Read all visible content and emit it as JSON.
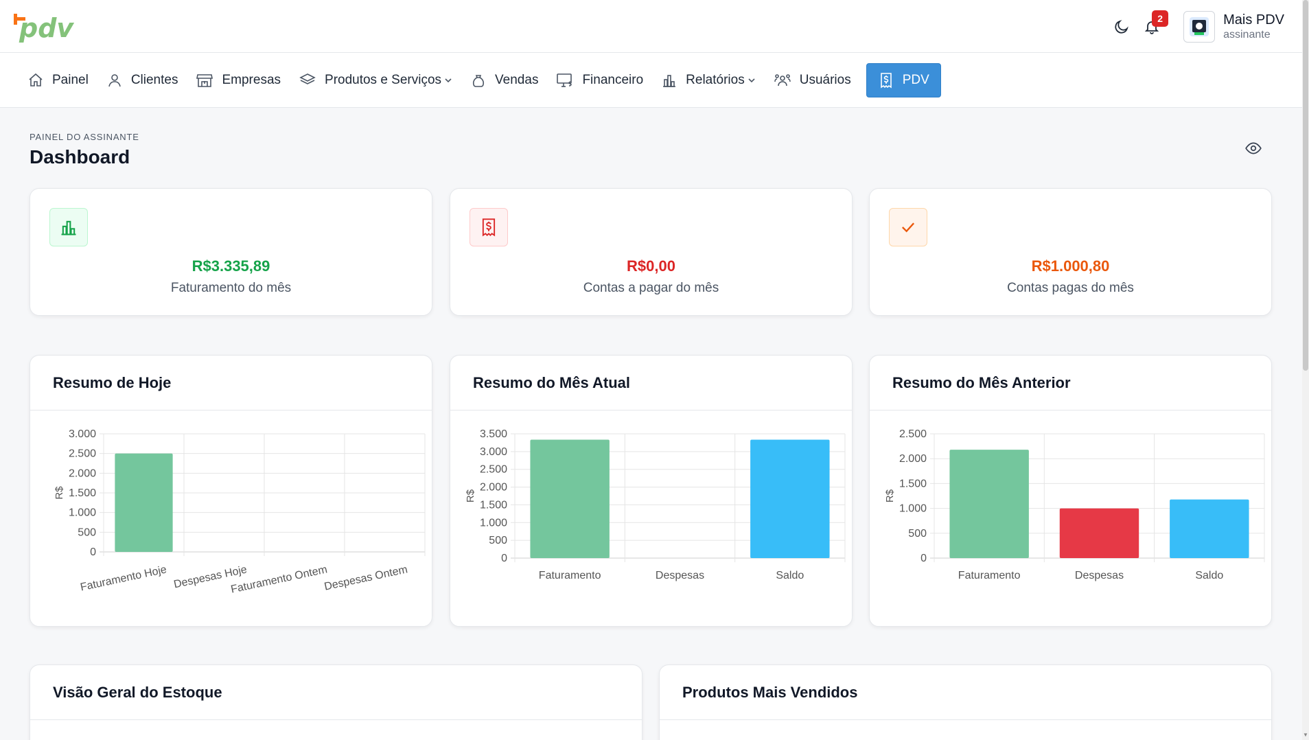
{
  "header": {
    "notification_count": "2",
    "user_name": "Mais PDV",
    "user_role": "assinante"
  },
  "nav": {
    "items": [
      {
        "label": "Painel",
        "icon": "home-icon"
      },
      {
        "label": "Clientes",
        "icon": "user-icon"
      },
      {
        "label": "Empresas",
        "icon": "store-icon"
      },
      {
        "label": "Produtos e Serviços",
        "icon": "layers-icon",
        "dropdown": true
      },
      {
        "label": "Vendas",
        "icon": "bag-icon"
      },
      {
        "label": "Financeiro",
        "icon": "monitor-money-icon"
      },
      {
        "label": "Relatórios",
        "icon": "bar-chart-icon",
        "dropdown": true
      },
      {
        "label": "Usuários",
        "icon": "users-icon"
      },
      {
        "label": "PDV",
        "icon": "receipt-dollar-icon",
        "active": true
      }
    ]
  },
  "page": {
    "breadcrumb": "PAINEL DO ASSINANTE",
    "title": "Dashboard"
  },
  "stats": [
    {
      "value": "R$3.335,89",
      "label": "Faturamento do mês",
      "color": "#16a34a",
      "icon": "bar-chart-icon"
    },
    {
      "value": "R$0,00",
      "label": "Contas a pagar do mês",
      "color": "#dc2626",
      "icon": "receipt-dollar-icon"
    },
    {
      "value": "R$1.000,80",
      "label": "Contas pagas do mês",
      "color": "#ea580c",
      "icon": "check-icon"
    }
  ],
  "chart_data": [
    {
      "type": "bar",
      "title": "Resumo de Hoje",
      "ylabel": "R$",
      "categories": [
        "Faturamento Hoje",
        "Despesas Hoje",
        "Faturamento Ontem",
        "Despesas Ontem"
      ],
      "values": [
        2500,
        0,
        0,
        0
      ],
      "colors": [
        "#74c69d",
        "#e63946",
        "#74c69d",
        "#e63946"
      ],
      "ylim": [
        0,
        3000
      ],
      "yticks": [
        0,
        500,
        1000,
        1500,
        2000,
        2500,
        3000
      ],
      "ytick_labels": [
        "0",
        "500",
        "1.000",
        "1.500",
        "2.000",
        "2.500",
        "3.000"
      ],
      "rotate_labels": true,
      "grid": true
    },
    {
      "type": "bar",
      "title": "Resumo do Mês Atual",
      "ylabel": "R$",
      "categories": [
        "Faturamento",
        "Despesas",
        "Saldo"
      ],
      "values": [
        3335.89,
        0,
        3335.89
      ],
      "colors": [
        "#74c69d",
        "#e63946",
        "#38bdf8"
      ],
      "ylim": [
        0,
        3500
      ],
      "yticks": [
        0,
        500,
        1000,
        1500,
        2000,
        2500,
        3000,
        3500
      ],
      "ytick_labels": [
        "0",
        "500",
        "1.000",
        "1.500",
        "2.000",
        "2.500",
        "3.000",
        "3.500"
      ],
      "rotate_labels": false,
      "grid": true
    },
    {
      "type": "bar",
      "title": "Resumo do Mês Anterior",
      "ylabel": "R$",
      "categories": [
        "Faturamento",
        "Despesas",
        "Saldo"
      ],
      "values": [
        2180,
        1000,
        1180
      ],
      "colors": [
        "#74c69d",
        "#e63946",
        "#38bdf8"
      ],
      "ylim": [
        0,
        2500
      ],
      "yticks": [
        0,
        500,
        1000,
        1500,
        2000,
        2500
      ],
      "ytick_labels": [
        "0",
        "500",
        "1.000",
        "1.500",
        "2.000",
        "2.500"
      ],
      "rotate_labels": false,
      "grid": true
    }
  ],
  "bottom": {
    "stock_title": "Visão Geral do Estoque",
    "top_products_title": "Produtos Mais Vendidos"
  }
}
